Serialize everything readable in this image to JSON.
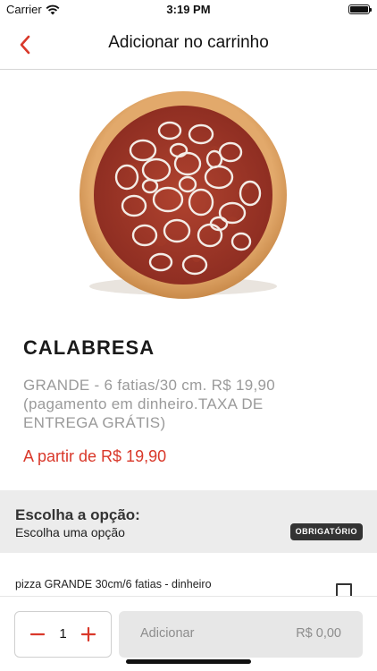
{
  "status_bar": {
    "carrier": "Carrier",
    "time": "3:19 PM",
    "wifi_icon": "wifi-icon",
    "battery_icon": "battery-icon"
  },
  "nav": {
    "title": "Adicionar no carrinho",
    "back_icon": "chevron-left-icon"
  },
  "product": {
    "image": "pizza-calabresa-image",
    "name": "CALABRESA",
    "description": "GRANDE - 6 fatias/30 cm. R$ 19,90 (pagamento em dinheiro.TAXA DE ENTREGA GRÁTIS)",
    "price": "A partir de R$ 19,90"
  },
  "options": {
    "title": "Escolha a opção:",
    "subtitle": "Escolha uma opção",
    "badge": "OBRIGATÓRIO",
    "items": [
      {
        "label": "pizza GRANDE 30cm/6 fatias - dinheiro",
        "checked": false
      }
    ]
  },
  "cart": {
    "quantity": "1",
    "add_label": "Adicionar",
    "total": "R$ 0,00"
  },
  "colors": {
    "accent": "#d9382a",
    "muted_text": "#9a9a9a",
    "section_bg": "#ececec",
    "badge_bg": "#333333",
    "button_bg": "#e7e7e7"
  }
}
